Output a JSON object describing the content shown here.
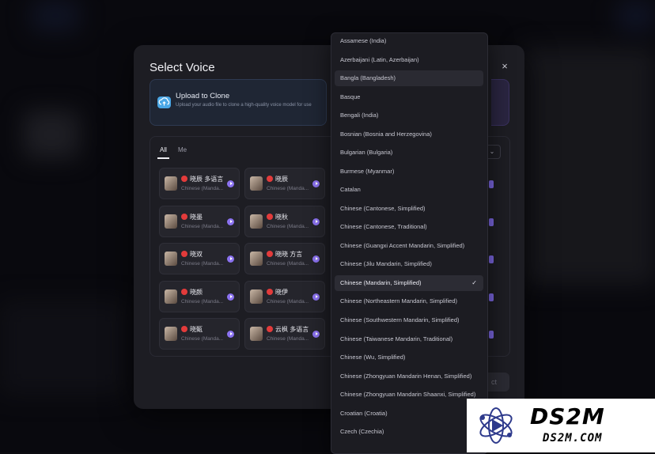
{
  "modal": {
    "title": "Select Voice",
    "close_icon": "×",
    "upload": {
      "title": "Upload to Clone",
      "subtitle": "Upload your audio file to clone a high-quality voice model for use"
    },
    "tabs": [
      {
        "label": "All",
        "active": true
      },
      {
        "label": "Me",
        "active": false
      }
    ],
    "filter_icon": "chevron-down-icon",
    "voices": [
      {
        "name": "晓辰 多语言",
        "lang": "Chinese (Manda..."
      },
      {
        "name": "晓辰",
        "lang": "Chinese (Manda..."
      },
      {
        "name": "晓墨",
        "lang": "Chinese (Manda..."
      },
      {
        "name": "晓秋",
        "lang": "Chinese (Manda..."
      },
      {
        "name": "晓双",
        "lang": "Chinese (Manda..."
      },
      {
        "name": "晓晓 方言",
        "lang": "Chinese (Manda..."
      },
      {
        "name": "晓颜",
        "lang": "Chinese (Manda..."
      },
      {
        "name": "晓伊",
        "lang": "Chinese (Manda..."
      },
      {
        "name": "晓甄",
        "lang": "Chinese (Manda..."
      },
      {
        "name": "云枫 多语言",
        "lang": "Chinese (Manda..."
      }
    ],
    "select_label": "ct"
  },
  "dropdown": {
    "options": [
      "Assamese (India)",
      "Azerbaijani (Latin, Azerbaijan)",
      "Bangla (Bangladesh)",
      "Basque",
      "Bengali (India)",
      "Bosnian (Bosnia and Herzegovina)",
      "Bulgarian (Bulgaria)",
      "Burmese (Myanmar)",
      "Catalan",
      "Chinese (Cantonese, Simplified)",
      "Chinese (Cantonese, Traditional)",
      "Chinese (Guangxi Accent Mandarin, Simplified)",
      "Chinese (Jilu Mandarin, Simplified)",
      "Chinese (Mandarin, Simplified)",
      "Chinese (Northeastern Mandarin, Simplified)",
      "Chinese (Southwestern Mandarin, Simplified)",
      "Chinese (Taiwanese Mandarin, Traditional)",
      "Chinese (Wu, Simplified)",
      "Chinese (Zhongyuan Mandarin Henan, Simplified)",
      "Chinese (Zhongyuan Mandarin Shaanxi, Simplified)",
      "Croatian (Croatia)",
      "Czech (Czechia)"
    ],
    "hover_index": 2,
    "selected_index": 13,
    "check_icon": "✓"
  },
  "watermark": {
    "big": "DS2M",
    "small": "DS2M.COM"
  }
}
